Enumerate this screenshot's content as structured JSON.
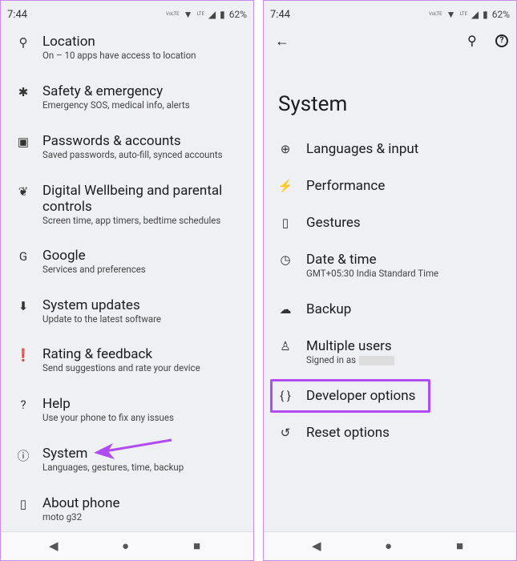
{
  "status": {
    "time": "7:44",
    "volte": "VoLTE",
    "lte": "LTE",
    "battery": "62%"
  },
  "left": {
    "items": [
      {
        "icon": "location-pin-icon",
        "glyph": "⚲",
        "title": "Location",
        "subtitle": "On – 10 apps have access to location"
      },
      {
        "icon": "asterisk-icon",
        "glyph": "✱",
        "title": "Safety & emergency",
        "subtitle": "Emergency SOS, medical info, alerts"
      },
      {
        "icon": "account-box-icon",
        "glyph": "▣",
        "title": "Passwords & accounts",
        "subtitle": "Saved passwords, auto-fill, synced accounts"
      },
      {
        "icon": "wellbeing-icon",
        "glyph": "❦",
        "title": "Digital Wellbeing and parental controls",
        "subtitle": "Screen time, app timers, bedtime schedules"
      },
      {
        "icon": "google-icon",
        "glyph": "G",
        "title": "Google",
        "subtitle": "Services and preferences"
      },
      {
        "icon": "system-update-icon",
        "glyph": "⬇",
        "title": "System updates",
        "subtitle": "Update to the latest software"
      },
      {
        "icon": "feedback-icon",
        "glyph": "❗",
        "title": "Rating & feedback",
        "subtitle": "Send suggestions and rate your device"
      },
      {
        "icon": "help-icon",
        "glyph": "?",
        "title": "Help",
        "subtitle": "Use your phone to fix any issues"
      },
      {
        "icon": "info-icon",
        "glyph": "ⓘ",
        "title": "System",
        "subtitle": "Languages, gestures, time, backup"
      },
      {
        "icon": "phone-info-icon",
        "glyph": "▯",
        "title": "About phone",
        "subtitle": "moto g32"
      }
    ]
  },
  "right": {
    "title": "System",
    "items": [
      {
        "icon": "globe-icon",
        "glyph": "⊕",
        "title": "Languages & input"
      },
      {
        "icon": "performance-icon",
        "glyph": "⚡",
        "title": "Performance"
      },
      {
        "icon": "gestures-icon",
        "glyph": "▯",
        "title": "Gestures"
      },
      {
        "icon": "clock-icon",
        "glyph": "◷",
        "title": "Date & time",
        "subtitle": "GMT+05:30 India Standard Time"
      },
      {
        "icon": "cloud-upload-icon",
        "glyph": "☁",
        "title": "Backup"
      },
      {
        "icon": "person-icon",
        "glyph": "♙",
        "title": "Multiple users",
        "subtitle": "Signed in as"
      },
      {
        "icon": "braces-icon",
        "glyph": "{ }",
        "title": "Developer options"
      },
      {
        "icon": "history-icon",
        "glyph": "↺",
        "title": "Reset options"
      }
    ]
  },
  "nav": {
    "back": "◀",
    "home": "●",
    "recents": "■"
  },
  "highlight_color": "#b14cf0"
}
